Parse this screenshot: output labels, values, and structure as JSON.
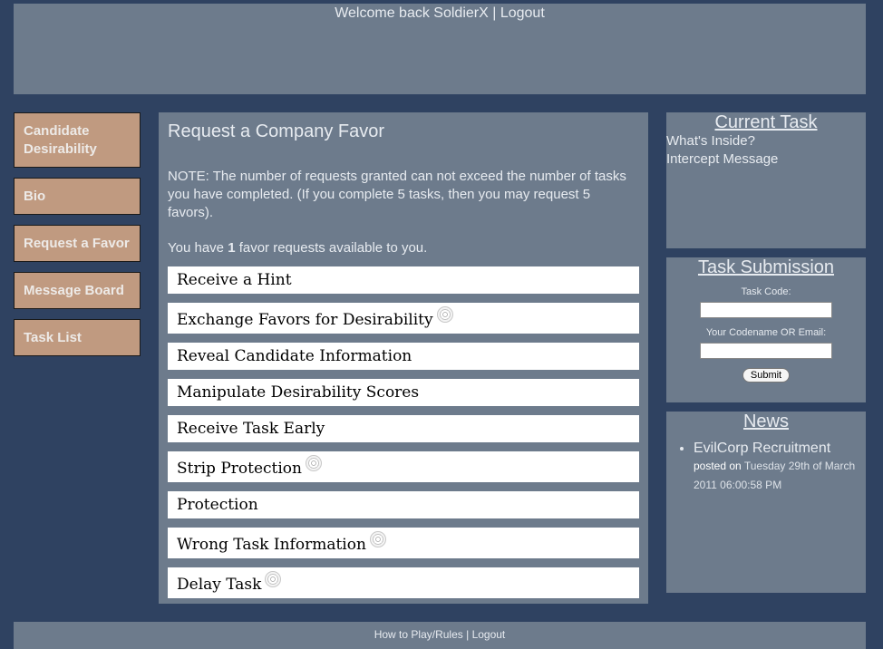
{
  "header": {
    "welcome": "Welcome back SoldierX",
    "separator": " | ",
    "logout": "Logout"
  },
  "nav": {
    "items": [
      {
        "label": "Candidate Desirability"
      },
      {
        "label": "Bio"
      },
      {
        "label": "Request a Favor"
      },
      {
        "label": "Message Board"
      },
      {
        "label": "Task List"
      }
    ]
  },
  "main": {
    "title": "Request a Company Favor",
    "note": "NOTE: The number of requests granted can not exceed the number of tasks you have completed. (If you complete 5 tasks, then you may request 5 favors).",
    "available_prefix": "You have ",
    "available_count": "1",
    "available_suffix": " favor requests available to you.",
    "favors": [
      {
        "label": "Receive a Hint",
        "info": false
      },
      {
        "label": "Exchange Favors for Desirability",
        "info": true
      },
      {
        "label": "Reveal Candidate Information",
        "info": false
      },
      {
        "label": "Manipulate Desirability Scores",
        "info": false
      },
      {
        "label": "Receive Task Early",
        "info": false
      },
      {
        "label": "Strip Protection",
        "info": true
      },
      {
        "label": "Protection",
        "info": false
      },
      {
        "label": "Wrong Task Information",
        "info": true
      },
      {
        "label": "Delay Task",
        "info": true
      }
    ]
  },
  "current_task": {
    "title": "Current Task",
    "items": [
      "What's Inside?",
      "Intercept Message"
    ]
  },
  "task_submission": {
    "title": "Task Submission",
    "code_label": "Task Code:",
    "code_value": "",
    "name_label": "Your Codename OR Email:",
    "name_value": "",
    "submit": "Submit"
  },
  "news": {
    "title": "News",
    "items": [
      {
        "headline": "EvilCorp Recruitment",
        "posted_on": "posted on",
        "date": "Tuesday 29th of March 2011 06:00:58 PM"
      }
    ]
  },
  "footer": {
    "rules": "How to Play/Rules",
    "separator": " | ",
    "logout": "Logout"
  }
}
